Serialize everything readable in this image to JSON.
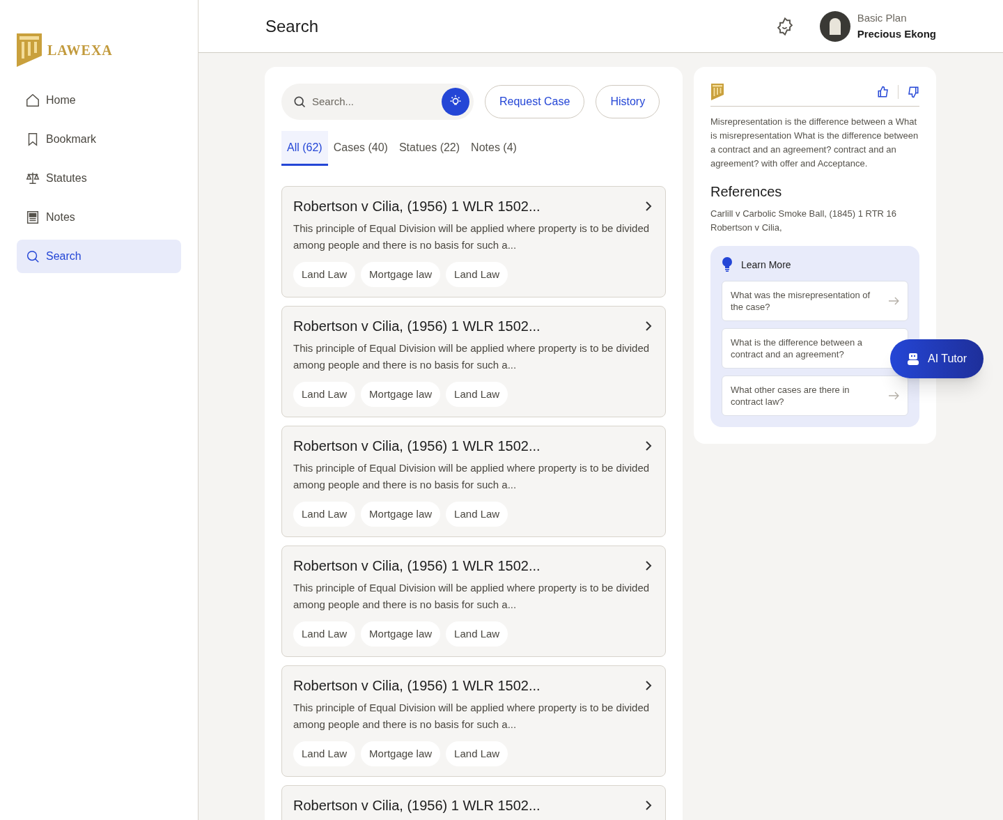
{
  "brand": {
    "name": "LAWEXA"
  },
  "sidebar": {
    "items": [
      {
        "label": "Home",
        "kind": "home",
        "selected": false
      },
      {
        "label": "Bookmark",
        "kind": "bookmark",
        "selected": false
      },
      {
        "label": "Statutes",
        "kind": "scale",
        "selected": false
      },
      {
        "label": "Notes",
        "kind": "notes",
        "selected": false
      },
      {
        "label": "Search",
        "kind": "search",
        "selected": true
      }
    ]
  },
  "header": {
    "title": "Search",
    "user": {
      "plan": "Basic Plan",
      "name": "Precious Ekong"
    }
  },
  "search": {
    "placeholder": "Search...",
    "buttons": [
      "Request Case",
      "History"
    ]
  },
  "tabs": [
    {
      "label": "All (62)",
      "selected": true
    },
    {
      "label": "Cases (40)",
      "selected": false
    },
    {
      "label": "Statues (22)",
      "selected": false
    },
    {
      "label": "Notes (4)",
      "selected": false
    }
  ],
  "results": [
    {
      "title": "Robertson v Cilia, (1956) 1 WLR 1502...",
      "summary": "This principle of Equal Division will be applied where property is to be divided among people and there is no basis for such a...",
      "tags": [
        "Land Law",
        "Mortgage law",
        "Land Law"
      ]
    },
    {
      "title": "Robertson v Cilia, (1956) 1 WLR 1502...",
      "summary": "This principle of Equal Division will be applied where property is to be divided among people and there is no basis for such a...",
      "tags": [
        "Land Law",
        "Mortgage law",
        "Land Law"
      ]
    },
    {
      "title": "Robertson v Cilia, (1956) 1 WLR 1502...",
      "summary": "This principle of Equal Division will be applied where property is to be divided among people and there is no basis for such a...",
      "tags": [
        "Land Law",
        "Mortgage law",
        "Land Law"
      ]
    },
    {
      "title": "Robertson v Cilia, (1956) 1 WLR 1502...",
      "summary": "This principle of Equal Division will be applied where property is to be divided among people and there is no basis for such a...",
      "tags": [
        "Land Law",
        "Mortgage law",
        "Land Law"
      ]
    },
    {
      "title": "Robertson v Cilia, (1956) 1 WLR 1502...",
      "summary": "This principle of Equal Division will be applied where property is to be divided among people and there is no basis for such a...",
      "tags": [
        "Land Law",
        "Mortgage law",
        "Land Law"
      ]
    },
    {
      "title": "Robertson v Cilia, (1956) 1 WLR 1502..."
    }
  ],
  "answer": {
    "text": "Misrepresentation is the difference between a What is misrepresentation What is the difference between a contract and an agreement? contract and an agreement? with offer and Acceptance.",
    "references_title": "References",
    "references": [
      "Carlill v Carbolic Smoke Ball, (1845) 1 RTR 16",
      "Robertson v Cilia,"
    ],
    "learn_more": {
      "title": "Learn More",
      "questions": [
        {
          "text": "What was the misrepresentation of the case?",
          "arrow": true
        },
        {
          "text": "What is the difference between a contract and an agreement?",
          "arrow": false
        },
        {
          "text": "What other cases are there in contract law?",
          "arrow": true
        }
      ]
    }
  },
  "ai_tutor": {
    "label": "AI Tutor"
  }
}
